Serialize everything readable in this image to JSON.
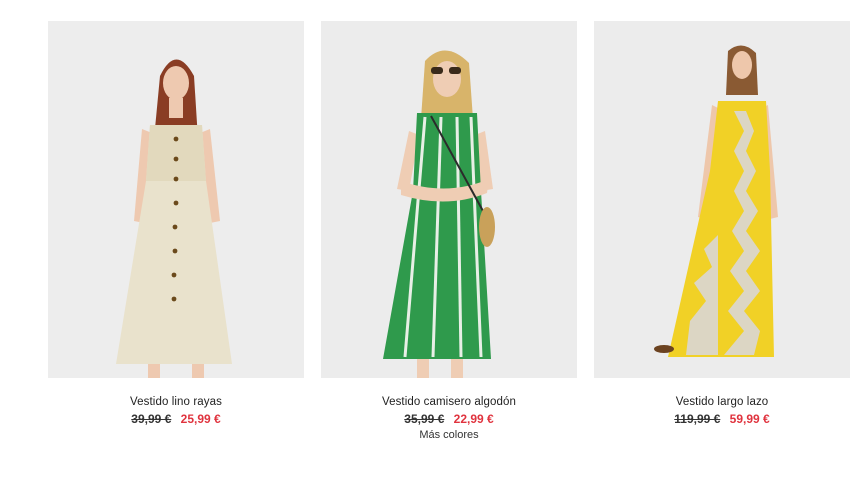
{
  "products": [
    {
      "name": "Vestido lino rayas",
      "old_price": "39,99 €",
      "sale_price": "25,99 €",
      "dress_color": "#e9e2cc"
    },
    {
      "name": "Vestido camisero algodón",
      "old_price": "35,99 €",
      "sale_price": "22,99 €",
      "more_colors": "Más colores",
      "dress_color": "#2f9a4c"
    },
    {
      "name": "Vestido largo lazo",
      "old_price": "119,99 €",
      "sale_price": "59,99 €",
      "dress_color": "#f1d126"
    }
  ],
  "colors": {
    "background": "#ffffff",
    "photo_bg": "#ededed",
    "sale_price": "#e0333e"
  }
}
